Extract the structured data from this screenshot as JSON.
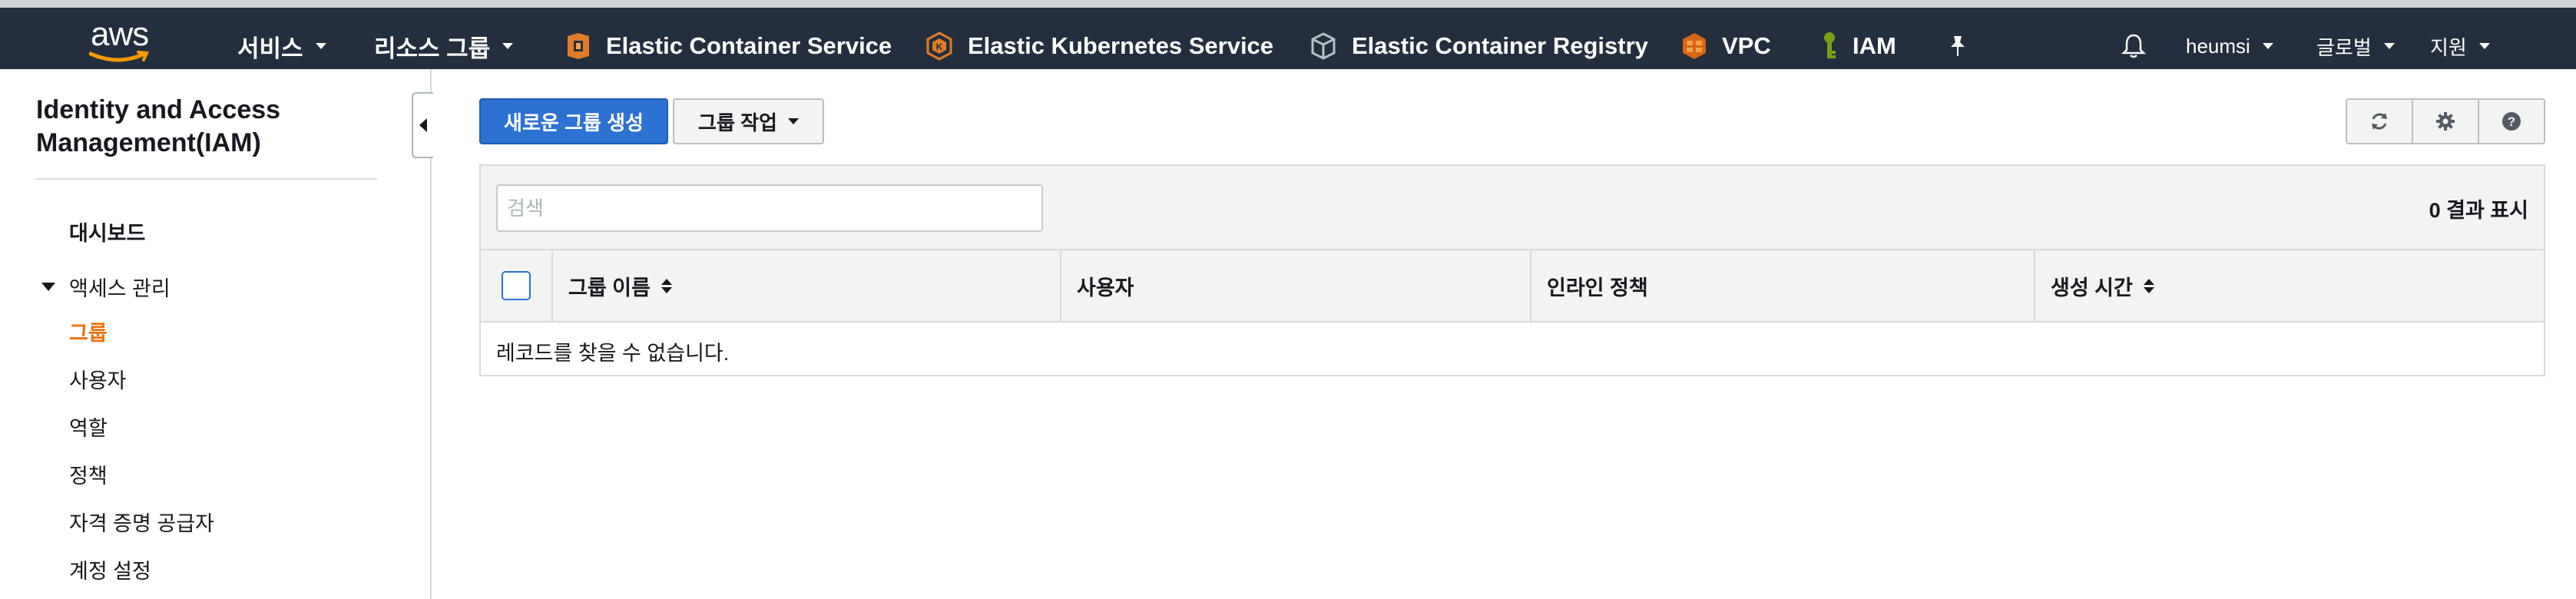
{
  "topnav": {
    "logo_text": "aws",
    "services_label": "서비스",
    "resource_groups_label": "리소스 그룹",
    "pinned": [
      {
        "label": "Elastic Container Service",
        "icon": "ecs-icon"
      },
      {
        "label": "Elastic Kubernetes Service",
        "icon": "eks-icon"
      },
      {
        "label": "Elastic Container Registry",
        "icon": "ecr-icon"
      },
      {
        "label": "VPC",
        "icon": "vpc-icon"
      },
      {
        "label": "IAM",
        "icon": "iam-key-icon"
      }
    ],
    "pin_icon": "pushpin-icon",
    "bell_icon": "bell-icon",
    "account_label": "heumsi",
    "region_label": "글로벌",
    "support_label": "지원",
    "colors": {
      "bar": "#232f3e",
      "ecs_orange": "#e07b26",
      "vpc_orange": "#d86613"
    }
  },
  "sidebar": {
    "title": "Identity and Access Management(IAM)",
    "dashboard_label": "대시보드",
    "section_label": "액세스 관리",
    "items": [
      {
        "label": "그룹",
        "active": true
      },
      {
        "label": "사용자",
        "active": false
      },
      {
        "label": "역할",
        "active": false
      },
      {
        "label": "정책",
        "active": false
      },
      {
        "label": "자격 증명 공급자",
        "active": false
      },
      {
        "label": "계정 설정",
        "active": false
      }
    ],
    "colors": {
      "active": "#ec7211"
    }
  },
  "toolbar": {
    "create_group_label": "새로운 그룹 생성",
    "group_actions_label": "그룹 작업",
    "refresh_icon": "refresh-icon",
    "settings_icon": "gear-icon",
    "help_icon": "help-icon",
    "colors": {
      "primary": "#2d72d2"
    }
  },
  "table": {
    "search_placeholder": "검색",
    "search_value": "",
    "result_count": "0 결과 표시",
    "columns": [
      {
        "label": "그룹 이름",
        "sortable": true
      },
      {
        "label": "사용자",
        "sortable": false
      },
      {
        "label": "인라인 정책",
        "sortable": false
      },
      {
        "label": "생성 시간",
        "sortable": true
      }
    ],
    "empty_message": "레코드를 찾을 수 없습니다."
  }
}
